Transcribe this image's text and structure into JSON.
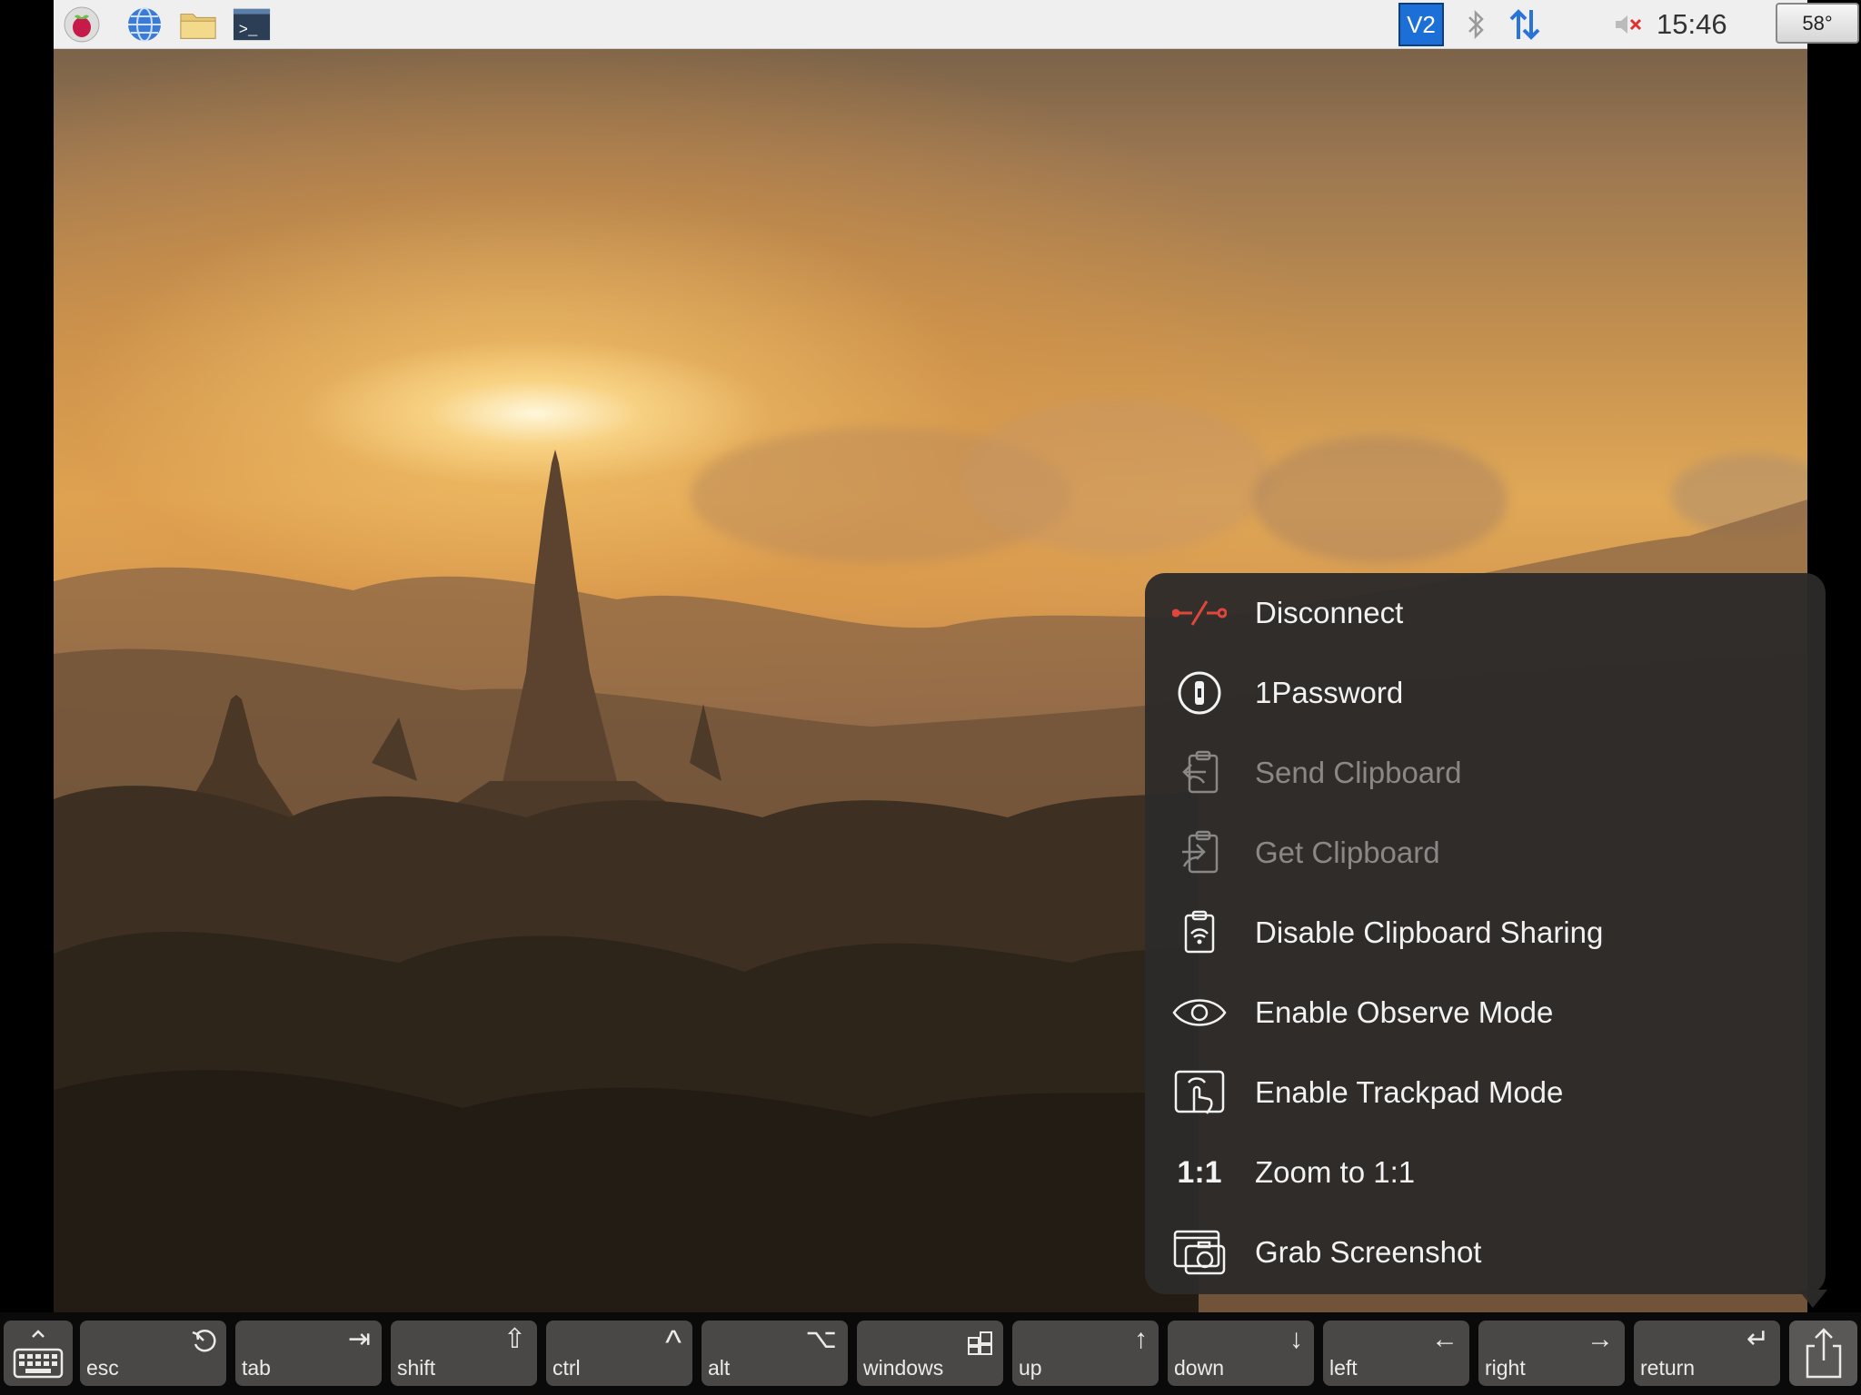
{
  "panel": {
    "clock": "15:46",
    "temperature": "58°",
    "launcher_icons": [
      "raspberry-icon",
      "globe-icon",
      "folder-icon",
      "terminal-icon"
    ],
    "tray_icons": [
      "vnc-icon",
      "bluetooth-icon",
      "network-arrows-icon",
      "volume-muted-icon"
    ],
    "tray_vnc_text": "V2"
  },
  "menu": {
    "items": [
      {
        "label": "Disconnect",
        "icon": "disconnect-icon",
        "enabled": true
      },
      {
        "label": "1Password",
        "icon": "onepassword-icon",
        "enabled": true
      },
      {
        "label": "Send Clipboard",
        "icon": "send-clipboard-icon",
        "enabled": false
      },
      {
        "label": "Get Clipboard",
        "icon": "get-clipboard-icon",
        "enabled": false
      },
      {
        "label": "Disable Clipboard Sharing",
        "icon": "clipboard-sharing-icon",
        "enabled": true
      },
      {
        "label": "Enable Observe Mode",
        "icon": "eye-icon",
        "enabled": true
      },
      {
        "label": "Enable Trackpad Mode",
        "icon": "trackpad-icon",
        "enabled": true
      },
      {
        "label": "Zoom to 1:1",
        "icon": "zoom-1-1-icon",
        "icon_text": "1:1",
        "enabled": true
      },
      {
        "label": "Grab Screenshot",
        "icon": "screenshot-icon",
        "enabled": true
      }
    ]
  },
  "keybar": {
    "keys": [
      {
        "label": "esc",
        "symbol": "esc-icon"
      },
      {
        "label": "tab",
        "symbol": "⇥"
      },
      {
        "label": "shift",
        "symbol": "⇧"
      },
      {
        "label": "ctrl",
        "symbol": "^"
      },
      {
        "label": "alt",
        "symbol": "⌥"
      },
      {
        "label": "windows",
        "symbol": "windows-icon"
      },
      {
        "label": "up",
        "symbol": "↑"
      },
      {
        "label": "down",
        "symbol": "↓"
      },
      {
        "label": "left",
        "symbol": "←"
      },
      {
        "label": "right",
        "symbol": "→"
      },
      {
        "label": "return",
        "symbol": "↵"
      }
    ],
    "keyboard_toggle": "keyboard-icon",
    "share_button": "share-icon"
  },
  "colors": {
    "menu_bg": "#2d2b2a",
    "disconnect_accent": "#e0473a",
    "vnc_blue": "#1b6fd6",
    "key_bg": "#4a4846"
  }
}
